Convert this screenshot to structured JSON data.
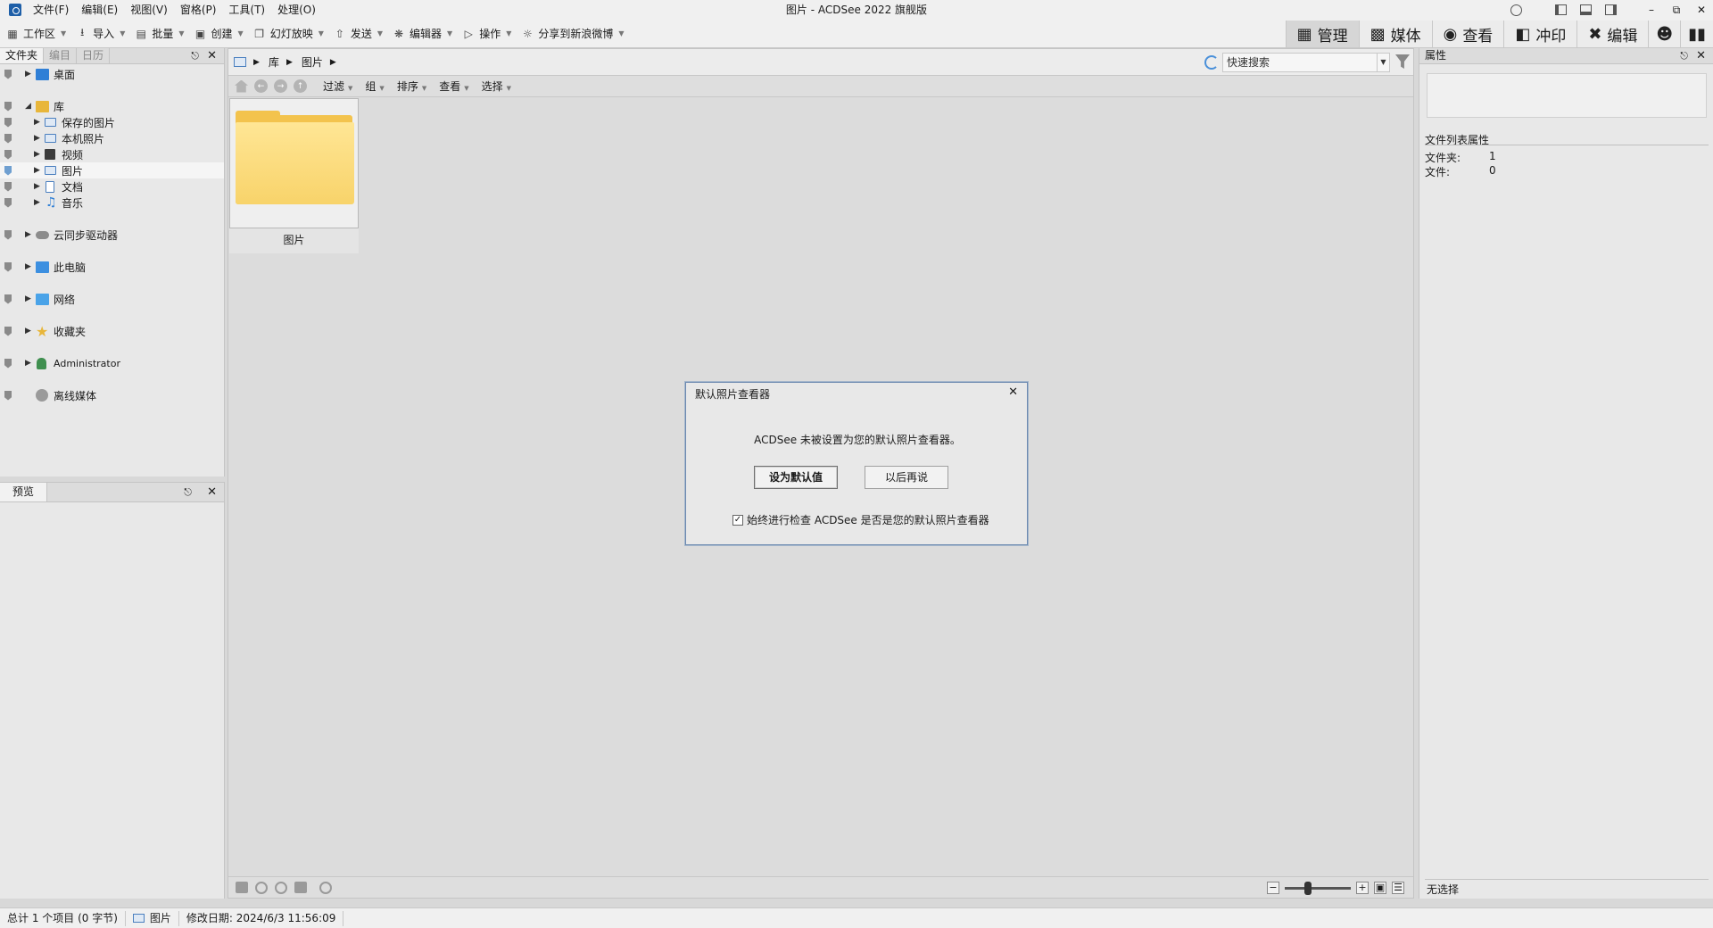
{
  "window": {
    "title": "图片 - ACDSee 2022 旗舰版"
  },
  "menu": [
    "文件(F)",
    "编辑(E)",
    "视图(V)",
    "窗格(P)",
    "工具(T)",
    "处理(O)"
  ],
  "toolbar": {
    "items": [
      {
        "label": "工作区",
        "icon": "workspace-icon"
      },
      {
        "label": "导入",
        "icon": "import-icon"
      },
      {
        "label": "批量",
        "icon": "batch-icon"
      },
      {
        "label": "创建",
        "icon": "create-icon"
      },
      {
        "label": "幻灯放映",
        "icon": "slideshow-icon"
      },
      {
        "label": "发送",
        "icon": "send-icon"
      },
      {
        "label": "编辑器",
        "icon": "editor-icon"
      },
      {
        "label": "操作",
        "icon": "actions-icon"
      },
      {
        "label": "分享到新浪微博",
        "icon": "weibo-icon"
      }
    ],
    "modes": [
      {
        "label": "管理",
        "icon": "grid-icon"
      },
      {
        "label": "媒体",
        "icon": "media-icon"
      },
      {
        "label": "查看",
        "icon": "eye-icon"
      },
      {
        "label": "冲印",
        "icon": "develop-icon"
      },
      {
        "label": "编辑",
        "icon": "tools-icon"
      }
    ]
  },
  "left_pane": {
    "tabs": [
      "文件夹",
      "编目",
      "日历"
    ],
    "tree": [
      {
        "label": "桌面",
        "level": 0
      },
      {
        "label": "库",
        "level": 0
      },
      {
        "label": "保存的图片",
        "level": 1
      },
      {
        "label": "本机照片",
        "level": 1
      },
      {
        "label": "视频",
        "level": 1
      },
      {
        "label": "图片",
        "level": 1
      },
      {
        "label": "文档",
        "level": 1
      },
      {
        "label": "音乐",
        "level": 1
      },
      {
        "label": "云同步驱动器",
        "level": 0
      },
      {
        "label": "此电脑",
        "level": 0
      },
      {
        "label": "网络",
        "level": 0
      },
      {
        "label": "收藏夹",
        "level": 0
      },
      {
        "label": "Administrator",
        "level": 0
      },
      {
        "label": "离线媒体",
        "level": 0
      }
    ]
  },
  "preview_pane": {
    "tab": "预览"
  },
  "address": {
    "crumbs": [
      "库",
      "图片"
    ],
    "search_placeholder": "快速搜索"
  },
  "view_toolbar": [
    "过滤",
    "组",
    "排序",
    "查看",
    "选择"
  ],
  "files": [
    {
      "name": "图片",
      "type": "folder"
    }
  ],
  "properties": {
    "title": "属性",
    "list_title": "文件列表属性",
    "folders_label": "文件夹:",
    "folders_value": "1",
    "files_label": "文件:",
    "files_value": "0",
    "footer": "无选择"
  },
  "zoom": {
    "level": 0.35
  },
  "statusbar": {
    "total": "总计 1 个项目 (0 字节)",
    "location": "图片",
    "modified": "修改日期: 2024/6/3 11:56:09"
  },
  "dialog": {
    "title": "默认照片查看器",
    "message": "ACDSee 未被设置为您的默认照片查看器。",
    "primary_button": "设为默认值",
    "secondary_button": "以后再说",
    "checkbox_label": "始终进行检查 ACDSee 是否是您的默认照片查看器",
    "checkbox_checked": true
  },
  "colors": {
    "accent": "#1e5fa8",
    "folder": "#f3c34d",
    "selection": "#6f9fd0"
  }
}
